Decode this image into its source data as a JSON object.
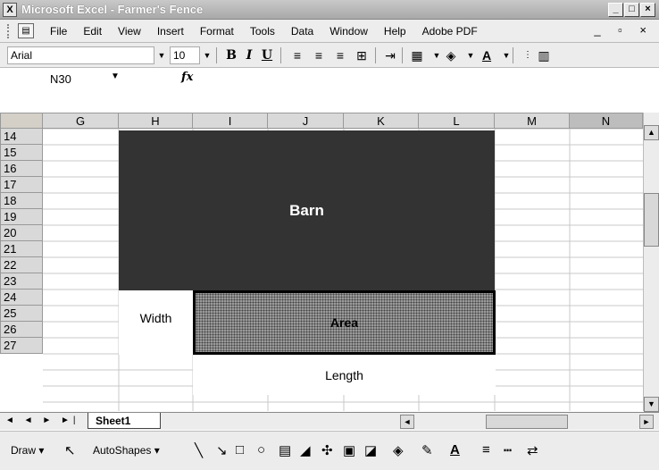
{
  "window": {
    "title": "Microsoft Excel - Farmer's Fence",
    "controls": [
      "_",
      "□",
      "×"
    ]
  },
  "menubar": {
    "items": [
      "File",
      "Edit",
      "View",
      "Insert",
      "Format",
      "Tools",
      "Data",
      "Window",
      "Help",
      "Adobe PDF"
    ],
    "mdi_controls": "_ ♂ ×"
  },
  "toolbar": {
    "font_name": "Arial",
    "font_size": "10",
    "bold": "B",
    "italic": "I",
    "underline": "U",
    "font_color_label": "A"
  },
  "formula": {
    "cell_ref": "N30",
    "fx_label": "fx",
    "value": ""
  },
  "grid": {
    "columns": [
      "G",
      "H",
      "I",
      "J",
      "K",
      "L",
      "M",
      "N"
    ],
    "rows": [
      "14",
      "15",
      "16",
      "17",
      "18",
      "19",
      "20",
      "21",
      "22",
      "23",
      "24",
      "25",
      "26",
      "27"
    ]
  },
  "shapes": {
    "barn": "Barn",
    "area": "Area",
    "width": "Width",
    "length": "Length"
  },
  "sheets": {
    "tabs": [
      "Sheet1"
    ],
    "nav": "◄ ◄ ► ►|"
  },
  "drawing": {
    "draw_label": "Draw ▾",
    "autoshapes_label": "AutoShapes ▾"
  }
}
